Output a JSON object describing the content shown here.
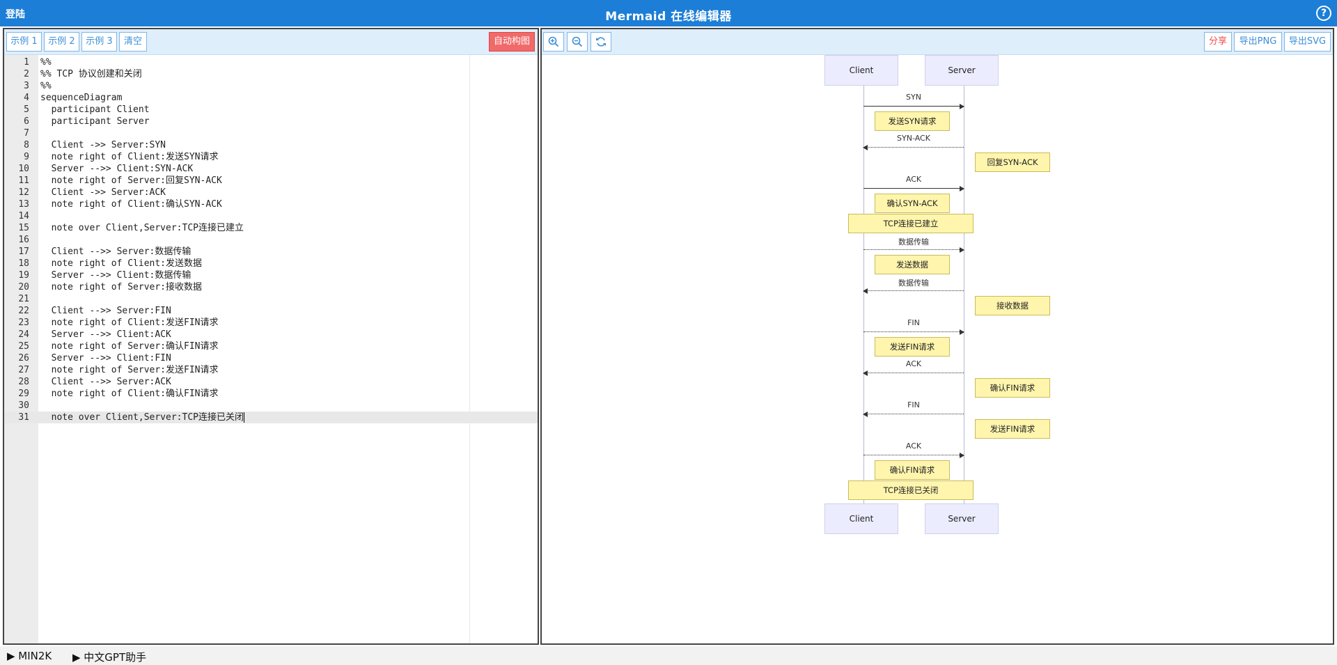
{
  "header": {
    "login": "登陆",
    "title": "Mermaid 在线编辑器",
    "help": "?"
  },
  "left_toolbar": {
    "example1": "示例 1",
    "example2": "示例 2",
    "example3": "示例 3",
    "clear": "清空",
    "auto_layout": "自动构图"
  },
  "right_toolbar": {
    "zoom_in_icon": "zoom-in-icon",
    "zoom_out_icon": "zoom-out-icon",
    "refresh_icon": "refresh-icon",
    "share": "分享",
    "export_png": "导出PNG",
    "export_svg": "导出SVG"
  },
  "editor": {
    "active_line": 31,
    "lines": [
      {
        "n": "1",
        "t": "%%"
      },
      {
        "n": "2",
        "t": "%% TCP 协议创建和关闭"
      },
      {
        "n": "3",
        "t": "%%"
      },
      {
        "n": "4",
        "t": "sequenceDiagram"
      },
      {
        "n": "5",
        "t": "  participant Client"
      },
      {
        "n": "6",
        "t": "  participant Server"
      },
      {
        "n": "7",
        "t": ""
      },
      {
        "n": "8",
        "t": "  Client ->> Server:SYN"
      },
      {
        "n": "9",
        "t": "  note right of Client:发送SYN请求"
      },
      {
        "n": "10",
        "t": "  Server -->> Client:SYN-ACK"
      },
      {
        "n": "11",
        "t": "  note right of Server:回复SYN-ACK"
      },
      {
        "n": "12",
        "t": "  Client ->> Server:ACK"
      },
      {
        "n": "13",
        "t": "  note right of Client:确认SYN-ACK"
      },
      {
        "n": "14",
        "t": ""
      },
      {
        "n": "15",
        "t": "  note over Client,Server:TCP连接已建立"
      },
      {
        "n": "16",
        "t": ""
      },
      {
        "n": "17",
        "t": "  Client -->> Server:数据传输"
      },
      {
        "n": "18",
        "t": "  note right of Client:发送数据"
      },
      {
        "n": "19",
        "t": "  Server -->> Client:数据传输"
      },
      {
        "n": "20",
        "t": "  note right of Server:接收数据"
      },
      {
        "n": "21",
        "t": ""
      },
      {
        "n": "22",
        "t": "  Client -->> Server:FIN"
      },
      {
        "n": "23",
        "t": "  note right of Client:发送FIN请求"
      },
      {
        "n": "24",
        "t": "  Server -->> Client:ACK"
      },
      {
        "n": "25",
        "t": "  note right of Server:确认FIN请求"
      },
      {
        "n": "26",
        "t": "  Server -->> Client:FIN"
      },
      {
        "n": "27",
        "t": "  note right of Server:发送FIN请求"
      },
      {
        "n": "28",
        "t": "  Client -->> Server:ACK"
      },
      {
        "n": "29",
        "t": "  note right of Client:确认FIN请求"
      },
      {
        "n": "30",
        "t": ""
      },
      {
        "n": "31",
        "t": "  note over Client,Server:TCP连接已关闭"
      }
    ]
  },
  "diagram": {
    "actors": [
      "Client",
      "Server"
    ],
    "colors": {
      "actor_fill": "#ececff",
      "note_fill": "#fff5ad",
      "note_border": "#c9bb5a"
    },
    "messages": [
      {
        "label": "SYN",
        "dir": "right",
        "style": "solid"
      },
      {
        "label": "SYN-ACK",
        "dir": "left",
        "style": "dotted"
      },
      {
        "label": "ACK",
        "dir": "right",
        "style": "solid"
      },
      {
        "label": "数据传输",
        "dir": "right",
        "style": "dotted"
      },
      {
        "label": "数据传输",
        "dir": "left",
        "style": "dotted"
      },
      {
        "label": "FIN",
        "dir": "right",
        "style": "dotted"
      },
      {
        "label": "ACK",
        "dir": "left",
        "style": "dotted"
      },
      {
        "label": "FIN",
        "dir": "left",
        "style": "dotted"
      },
      {
        "label": "ACK",
        "dir": "right",
        "style": "dotted"
      }
    ],
    "notes": [
      {
        "text": "发送SYN请求",
        "place": "right-of-client"
      },
      {
        "text": "回复SYN-ACK",
        "place": "right-of-server"
      },
      {
        "text": "确认SYN-ACK",
        "place": "right-of-client"
      },
      {
        "text": "TCP连接已建立",
        "place": "over-both"
      },
      {
        "text": "发送数据",
        "place": "right-of-client"
      },
      {
        "text": "接收数据",
        "place": "right-of-server"
      },
      {
        "text": "发送FIN请求",
        "place": "right-of-client"
      },
      {
        "text": "确认FIN请求",
        "place": "right-of-server"
      },
      {
        "text": "发送FIN请求",
        "place": "right-of-server"
      },
      {
        "text": "确认FIN请求",
        "place": "right-of-client"
      },
      {
        "text": "TCP连接已关闭",
        "place": "over-both"
      }
    ]
  },
  "footer": {
    "link1": "▶ MIN2K",
    "link2": "▶ 中文GPT助手"
  }
}
